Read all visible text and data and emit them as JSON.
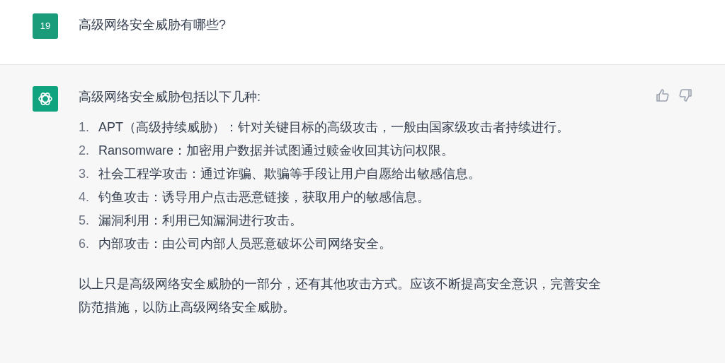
{
  "user_message": {
    "avatar_text": "19",
    "text": "高级网络安全威胁有哪些?"
  },
  "assistant_message": {
    "intro": "高级网络安全威胁包括以下几种:",
    "list": [
      {
        "number": "1.",
        "text": "APT（高级持续威胁）：针对关键目标的高级攻击，一般由国家级攻击者持续进行。"
      },
      {
        "number": "2.",
        "text": "Ransomware：加密用户数据并试图通过赎金收回其访问权限。"
      },
      {
        "number": "3.",
        "text": "社会工程学攻击：通过诈骗、欺骗等手段让用户自愿给出敏感信息。"
      },
      {
        "number": "4.",
        "text": "钓鱼攻击：诱导用户点击恶意链接，获取用户的敏感信息。"
      },
      {
        "number": "5.",
        "text": "漏洞利用：利用已知漏洞进行攻击。"
      },
      {
        "number": "6.",
        "text": "内部攻击：由公司内部人员恶意破坏公司网络安全。"
      }
    ],
    "conclusion": "以上只是高级网络安全威胁的一部分，还有其他攻击方式。应该不断提高安全意识，完善安全防范措施，以防止高级网络安全威胁。"
  }
}
